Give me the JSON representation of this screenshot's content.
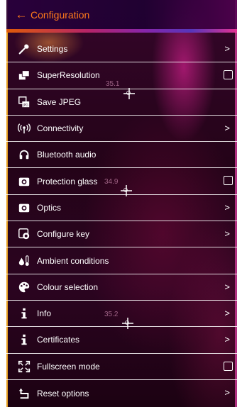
{
  "header": {
    "title": "Configuration",
    "back_icon": "arrow-left-icon"
  },
  "menu": [
    {
      "label": "Settings",
      "icon": "wrench-icon",
      "control": "chevron"
    },
    {
      "label": "SuperResolution",
      "icon": "superresolution-icon",
      "control": "checkbox",
      "checked": false
    },
    {
      "label": "Save JPEG",
      "icon": "jpeg-icon",
      "control": "none"
    },
    {
      "label": "Connectivity",
      "icon": "wireless-icon",
      "control": "chevron"
    },
    {
      "label": "Bluetooth audio",
      "icon": "headphones-icon",
      "control": "none"
    },
    {
      "label": "Protection glass",
      "icon": "camera-icon",
      "control": "checkbox",
      "checked": false
    },
    {
      "label": "Optics",
      "icon": "camera-icon",
      "control": "chevron"
    },
    {
      "label": "Configure key",
      "icon": "key-config-icon",
      "control": "chevron"
    },
    {
      "label": "Ambient conditions",
      "icon": "thermometer-icon",
      "control": "none"
    },
    {
      "label": "Colour selection",
      "icon": "palette-icon",
      "control": "chevron"
    },
    {
      "label": "Info",
      "icon": "info-icon",
      "control": "chevron"
    },
    {
      "label": "Certificates",
      "icon": "info-icon",
      "control": "chevron"
    },
    {
      "label": "Fullscreen mode",
      "icon": "fullscreen-icon",
      "control": "checkbox",
      "checked": false
    },
    {
      "label": "Reset options",
      "icon": "reset-icon",
      "control": "chevron"
    }
  ],
  "chevron_glyph": ">",
  "readouts": [
    "35.1",
    "34.9",
    "35.2"
  ]
}
